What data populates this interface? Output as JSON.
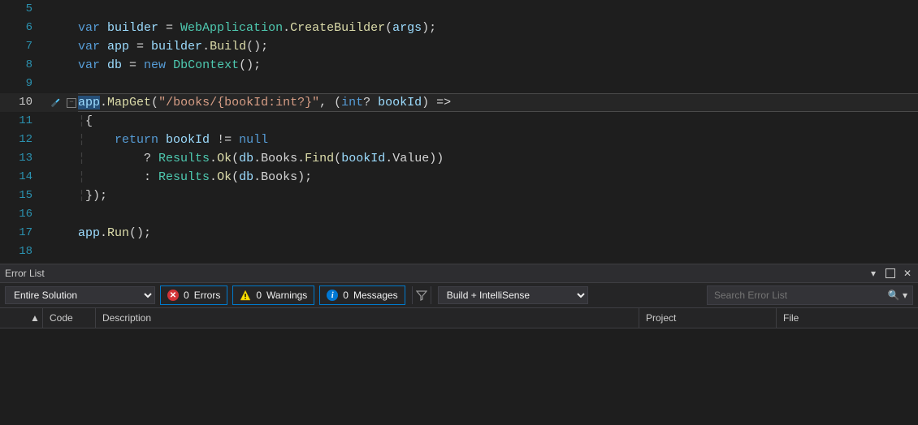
{
  "editor": {
    "activeLine": 10,
    "lines": [
      {
        "n": 5,
        "tokens": []
      },
      {
        "n": 6,
        "tokens": [
          {
            "t": "var ",
            "c": "kw"
          },
          {
            "t": "builder",
            "c": "loc"
          },
          {
            "t": " = ",
            "c": "pun"
          },
          {
            "t": "WebApplication",
            "c": "cls"
          },
          {
            "t": ".",
            "c": "pun"
          },
          {
            "t": "CreateBuilder",
            "c": "mth"
          },
          {
            "t": "(",
            "c": "pun"
          },
          {
            "t": "args",
            "c": "loc"
          },
          {
            "t": ");",
            "c": "pun"
          }
        ]
      },
      {
        "n": 7,
        "tokens": [
          {
            "t": "var ",
            "c": "kw"
          },
          {
            "t": "app",
            "c": "loc"
          },
          {
            "t": " = ",
            "c": "pun"
          },
          {
            "t": "builder",
            "c": "loc"
          },
          {
            "t": ".",
            "c": "pun"
          },
          {
            "t": "Build",
            "c": "mth"
          },
          {
            "t": "();",
            "c": "pun"
          }
        ]
      },
      {
        "n": 8,
        "tokens": [
          {
            "t": "var ",
            "c": "kw"
          },
          {
            "t": "db",
            "c": "loc"
          },
          {
            "t": " = ",
            "c": "pun"
          },
          {
            "t": "new ",
            "c": "kw"
          },
          {
            "t": "DbContext",
            "c": "cls"
          },
          {
            "t": "();",
            "c": "pun"
          }
        ]
      },
      {
        "n": 9,
        "tokens": []
      },
      {
        "n": 10,
        "fold": true,
        "active": true,
        "tokens": [
          {
            "t": "app",
            "c": "loc tkbg"
          },
          {
            "t": ".",
            "c": "pun"
          },
          {
            "t": "MapGet",
            "c": "mth"
          },
          {
            "t": "(",
            "c": "pun"
          },
          {
            "t": "\"/books/{bookId:int?}\"",
            "c": "str"
          },
          {
            "t": ", (",
            "c": "pun"
          },
          {
            "t": "int",
            "c": "kw"
          },
          {
            "t": "? ",
            "c": "pun"
          },
          {
            "t": "bookId",
            "c": "loc"
          },
          {
            "t": ") =>",
            "c": "pun"
          }
        ]
      },
      {
        "n": 11,
        "guides": 1,
        "tokens": [
          {
            "t": "{",
            "c": "pun"
          }
        ]
      },
      {
        "n": 12,
        "guides": 1,
        "tokens": [
          {
            "t": "    ",
            "c": "pun"
          },
          {
            "t": "return ",
            "c": "kw"
          },
          {
            "t": "bookId",
            "c": "loc"
          },
          {
            "t": " != ",
            "c": "pun"
          },
          {
            "t": "null",
            "c": "kw"
          }
        ]
      },
      {
        "n": 13,
        "guides": 1,
        "tokens": [
          {
            "t": "        ? ",
            "c": "pun"
          },
          {
            "t": "Results",
            "c": "cls"
          },
          {
            "t": ".",
            "c": "pun"
          },
          {
            "t": "Ok",
            "c": "mth"
          },
          {
            "t": "(",
            "c": "pun"
          },
          {
            "t": "db",
            "c": "loc"
          },
          {
            "t": ".",
            "c": "pun"
          },
          {
            "t": "Books",
            "c": "pun"
          },
          {
            "t": ".",
            "c": "pun"
          },
          {
            "t": "Find",
            "c": "mth"
          },
          {
            "t": "(",
            "c": "pun"
          },
          {
            "t": "bookId",
            "c": "loc"
          },
          {
            "t": ".",
            "c": "pun"
          },
          {
            "t": "Value",
            "c": "pun"
          },
          {
            "t": "))",
            "c": "pun"
          }
        ]
      },
      {
        "n": 14,
        "guides": 1,
        "tokens": [
          {
            "t": "        : ",
            "c": "pun"
          },
          {
            "t": "Results",
            "c": "cls"
          },
          {
            "t": ".",
            "c": "pun"
          },
          {
            "t": "Ok",
            "c": "mth"
          },
          {
            "t": "(",
            "c": "pun"
          },
          {
            "t": "db",
            "c": "loc"
          },
          {
            "t": ".",
            "c": "pun"
          },
          {
            "t": "Books",
            "c": "pun"
          },
          {
            "t": ");",
            "c": "pun"
          }
        ]
      },
      {
        "n": 15,
        "guides": 1,
        "tokens": [
          {
            "t": "});",
            "c": "pun"
          }
        ]
      },
      {
        "n": 16,
        "tokens": []
      },
      {
        "n": 17,
        "tokens": [
          {
            "t": "app",
            "c": "loc"
          },
          {
            "t": ".",
            "c": "pun"
          },
          {
            "t": "Run",
            "c": "mth"
          },
          {
            "t": "();",
            "c": "pun"
          }
        ]
      },
      {
        "n": 18,
        "tokens": []
      }
    ]
  },
  "errorList": {
    "title": "Error List",
    "scope": "Entire Solution",
    "build": "Build + IntelliSense",
    "errors": {
      "count": 0,
      "label": "Errors"
    },
    "warnings": {
      "count": 0,
      "label": "Warnings"
    },
    "messages": {
      "count": 0,
      "label": "Messages"
    },
    "search": {
      "placeholder": "Search Error List"
    },
    "columns": [
      "Code",
      "Description",
      "Project",
      "File"
    ]
  }
}
